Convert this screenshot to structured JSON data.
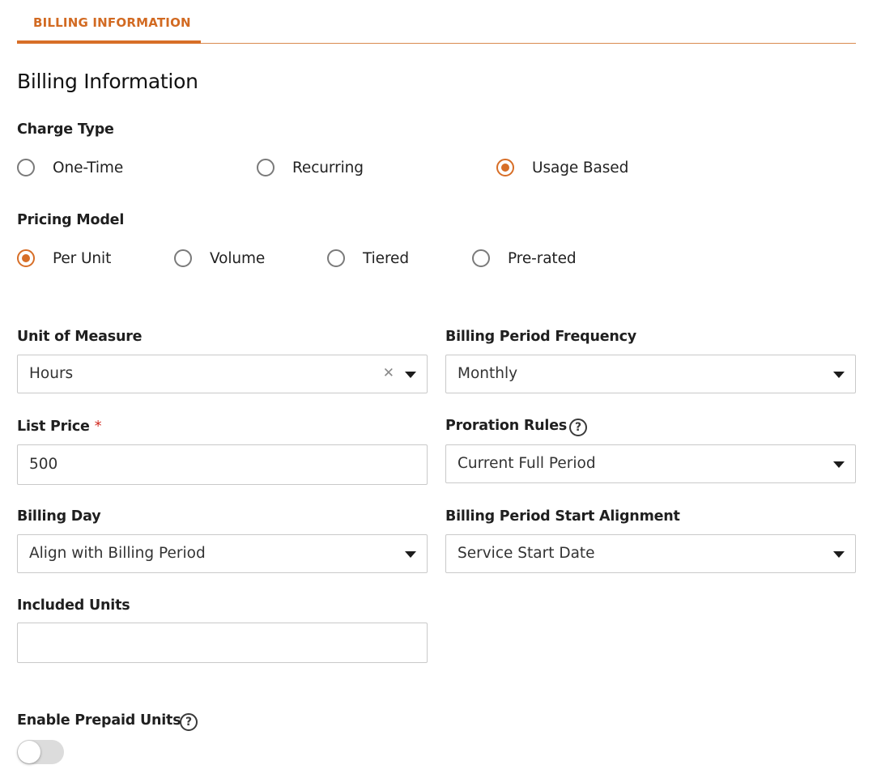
{
  "tab": {
    "label": "BILLING INFORMATION"
  },
  "page_title": "Billing Information",
  "charge_type": {
    "label": "Charge Type",
    "options": [
      "One-Time",
      "Recurring",
      "Usage Based"
    ],
    "selected": "Usage Based"
  },
  "pricing_model": {
    "label": "Pricing Model",
    "options": [
      "Per Unit",
      "Volume",
      "Tiered",
      "Pre-rated"
    ],
    "selected": "Per Unit"
  },
  "unit_of_measure": {
    "label": "Unit of Measure",
    "value": "Hours",
    "clear_icon": "close-icon"
  },
  "billing_period_frequency": {
    "label": "Billing Period Frequency",
    "value": "Monthly"
  },
  "list_price": {
    "label": "List Price",
    "required_mark": "*",
    "value": "500"
  },
  "proration_rules": {
    "label": "Proration Rules",
    "value": "Current Full Period",
    "help_glyph": "?"
  },
  "billing_day": {
    "label": "Billing Day",
    "value": "Align with Billing Period"
  },
  "billing_period_start_alignment": {
    "label": "Billing Period Start Alignment",
    "value": "Service Start Date"
  },
  "included_units": {
    "label": "Included Units",
    "value": ""
  },
  "enable_prepaid_units": {
    "label": "Enable Prepaid Units",
    "help_glyph": "?",
    "enabled": false
  },
  "colors": {
    "accent": "#d76e27",
    "required": "#d12a20",
    "border": "#c9c9c9",
    "toggle_off": "#dcdcdc"
  },
  "icons": {
    "dropdown": "chevron-down-icon",
    "help": "help-circle-icon",
    "clear": "close-icon"
  }
}
